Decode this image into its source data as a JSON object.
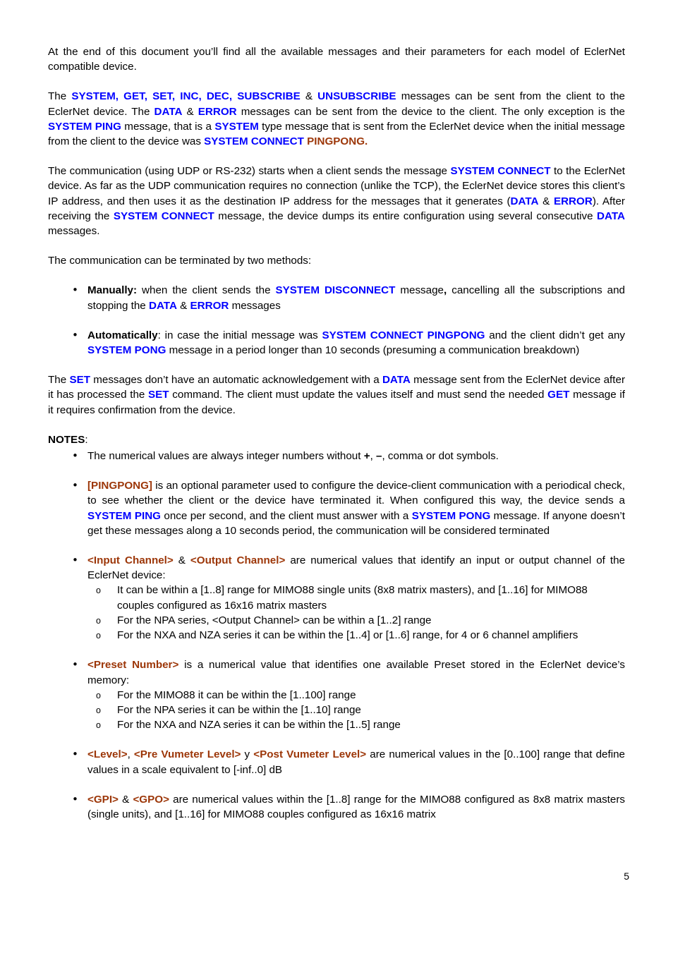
{
  "document": {
    "page_number": "5",
    "colors": {
      "keyword_blue": "#0000ff",
      "parameter_red": "#9c3608",
      "body_black": "#000000",
      "background": "#ffffff"
    }
  },
  "paragraphs": {
    "intro": {
      "t1": "At the end of this document you’ll find all the available messages and their parameters for each model of EclerNet compatible device."
    },
    "messages": {
      "t1": "The ",
      "kw1": "SYSTEM, GET, SET, INC, DEC, SUBSCRIBE",
      "t2": " & ",
      "kw2": "UNSUBSCRIBE",
      "t3": " messages can be sent from the client to the EclerNet device. The ",
      "kw3": "DATA",
      "t4": " & ",
      "kw4": "ERROR",
      "t5": " messages can be sent from the device to the client. The only exception is the ",
      "kw5": "SYSTEM PING",
      "t6": " message, that is a ",
      "kw6": "SYSTEM",
      "t7": " type message that is sent from the EclerNet device when the initial message from the client to the device was ",
      "kw7": "SYSTEM CONNECT",
      "t8": " ",
      "pm1": "PINGPONG."
    },
    "communication": {
      "t1": "The communication (using UDP or RS-232) starts when a client sends the message ",
      "kw1": "SYSTEM CONNECT",
      "t2": " to the EclerNet device. As far as the UDP communication requires no connection (unlike the TCP), the EclerNet device stores this client’s IP address, and then uses it as the destination IP address for the messages that it generates (",
      "kw2": "DATA",
      "t3": " & ",
      "kw3": "ERROR",
      "t4": "). After receiving the ",
      "kw4": "SYSTEM CONNECT",
      "t5": " message, the device dumps its entire configuration using several consecutive ",
      "kw5": "DATA",
      "t6": " messages."
    },
    "terminated": {
      "t1": "The communication can be terminated by two methods:"
    },
    "set_messages": {
      "t1": "The ",
      "kw1": "SET",
      "t2": " messages don’t have an automatic acknowledgement with a ",
      "kw2": "DATA",
      "t3": " message sent from the EclerNet device after it has processed the ",
      "kw3": "SET",
      "t4": " command. The client must update the values itself and must send the needed ",
      "kw4": "GET",
      "t5": " message if it requires confirmation from the device."
    }
  },
  "termination_bullets": {
    "bullet_glyph": "•",
    "items": [
      {
        "lead": "Manually:",
        "t1": " when the client sends the ",
        "kw1": "SYSTEM DISCONNECT",
        "t2": " message",
        "bold_comma": ",",
        "t3": " cancelling all the subscriptions and stopping the ",
        "kw2": "DATA",
        "t4": " & ",
        "kw3": "ERROR",
        "t5": " messages"
      },
      {
        "lead": "Automatically",
        "t1": ": in case the initial message was ",
        "kw1": "SYSTEM CONNECT PINGPONG",
        "t2": " and the client didn’t get any ",
        "kw2": "SYSTEM PONG",
        "t3": " message in a period longer than 10 seconds (presuming a communication breakdown)"
      }
    ]
  },
  "notes": {
    "heading": "NOTES",
    "heading_colon": ":",
    "bullet_glyph": "•",
    "sub_bullet_glyph": "o",
    "items": {
      "numerical": {
        "t1": "The numerical values are always integer numbers without ",
        "b1": "+",
        "t2": ", ",
        "b2": "–",
        "t3": ", comma or dot symbols."
      },
      "pingpong": {
        "pm1": "[PINGPONG]",
        "t1": " is an optional parameter used to configure the device-client communication with a periodical check, to see whether the client or the device have terminated it. When configured this way, the device sends a ",
        "kw1": "SYSTEM PING",
        "t2": " once per second, and the client must answer with a ",
        "kw2": "SYSTEM PONG",
        "t3": " message. If anyone doesn’t get these messages along a 10 seconds period, the communication will be considered terminated"
      },
      "channels": {
        "pm1": "<Input Channel>",
        "t1": " & ",
        "pm2": "<Output Channel>",
        "t2": " are numerical values that identify an input or output channel of the EclerNet device:",
        "sub": [
          "It can be within a [1..8] range for MIMO88 single units (8x8 matrix masters), and [1..16] for MIMO88 couples configured as 16x16 matrix masters",
          "For the NPA series, <Output Channel> can be within a [1..2] range",
          "For the NXA and NZA series it can be within the [1..4] or [1..6] range, for 4 or 6 channel amplifiers"
        ]
      },
      "preset": {
        "pm1": "<Preset Number>",
        "t1": " is a numerical value that identifies one available Preset stored in the EclerNet device’s memory:",
        "sub": [
          "For the MIMO88 it can be within the [1..100] range",
          "For the NPA series it can be within the [1..10] range",
          "For the NXA and NZA series it can be within the [1..5] range"
        ]
      },
      "levels": {
        "pm1": "<Level>",
        "t1": ", ",
        "pm2": "<Pre Vumeter Level>",
        "t2": " y ",
        "pm3": "<Post Vumeter Level>",
        "t3": " are numerical values in the [0..100] range that define values in a scale equivalent to [-inf..0] dB"
      },
      "gpio": {
        "pm1": "<GPI>",
        "t1": " & ",
        "pm2": "<GPO>",
        "t2": " are numerical values within the [1..8] range for the MIMO88 configured as 8x8 matrix masters (single units), and [1..16] for MIMO88 couples configured as 16x16 matrix"
      }
    }
  }
}
